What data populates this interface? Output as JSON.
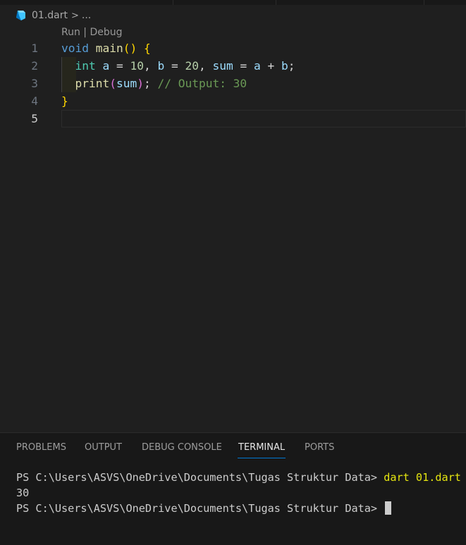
{
  "breadcrumb": {
    "file": "01.dart",
    "separator": ">",
    "more": "..."
  },
  "codelens": "Run | Debug",
  "editor": {
    "lines": [
      {
        "num": "1",
        "tokens": [
          [
            "kw",
            "void"
          ],
          [
            "op",
            " "
          ],
          [
            "fn",
            "main"
          ],
          [
            "br",
            "()"
          ],
          [
            "op",
            " "
          ],
          [
            "br",
            "{"
          ]
        ]
      },
      {
        "num": "2",
        "tokens": [
          [
            "op",
            "  "
          ],
          [
            "ty",
            "int"
          ],
          [
            "op",
            " "
          ],
          [
            "var",
            "a"
          ],
          [
            "op",
            " = "
          ],
          [
            "num",
            "10"
          ],
          [
            "op",
            ", "
          ],
          [
            "var",
            "b"
          ],
          [
            "op",
            " = "
          ],
          [
            "num",
            "20"
          ],
          [
            "op",
            ", "
          ],
          [
            "var",
            "sum"
          ],
          [
            "op",
            " = "
          ],
          [
            "var",
            "a"
          ],
          [
            "op",
            " + "
          ],
          [
            "var",
            "b"
          ],
          [
            "op",
            ";"
          ]
        ]
      },
      {
        "num": "3",
        "tokens": [
          [
            "op",
            "  "
          ],
          [
            "fn",
            "print"
          ],
          [
            "br2",
            "("
          ],
          [
            "var",
            "sum"
          ],
          [
            "br2",
            ")"
          ],
          [
            "op",
            "; "
          ],
          [
            "cm",
            "// Output: 30"
          ]
        ]
      },
      {
        "num": "4",
        "tokens": [
          [
            "br",
            "}"
          ]
        ]
      },
      {
        "num": "5",
        "tokens": []
      }
    ]
  },
  "panel": {
    "tabs": [
      {
        "label": "PROBLEMS"
      },
      {
        "label": "OUTPUT"
      },
      {
        "label": "DEBUG CONSOLE"
      },
      {
        "label": "TERMINAL"
      },
      {
        "label": "PORTS"
      }
    ],
    "active_tab": "TERMINAL"
  },
  "terminal": {
    "line1_prompt": "PS C:\\Users\\ASVS\\OneDrive\\Documents\\Tugas Struktur Data> ",
    "line1_command": "dart 01.dart",
    "line2_output": "30",
    "line3_prompt": "PS C:\\Users\\ASVS\\OneDrive\\Documents\\Tugas Struktur Data> "
  },
  "colors": {
    "editor_bg": "#1f1f1f",
    "panel_bg": "#181818",
    "accent": "#0078d4"
  }
}
